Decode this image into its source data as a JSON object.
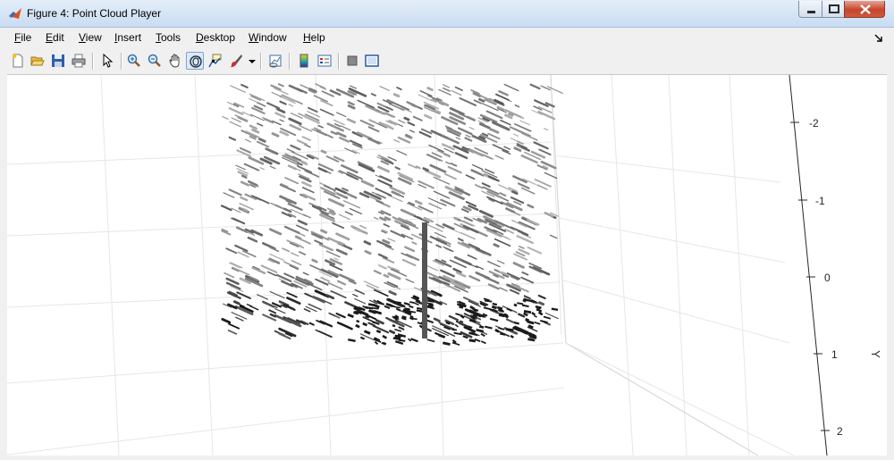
{
  "window": {
    "title": "Figure 4: Point Cloud Player"
  },
  "menu": [
    {
      "pre": "",
      "u": "F",
      "post": "ile"
    },
    {
      "pre": "",
      "u": "E",
      "post": "dit"
    },
    {
      "pre": "",
      "u": "V",
      "post": "iew"
    },
    {
      "pre": "",
      "u": "I",
      "post": "nsert"
    },
    {
      "pre": "",
      "u": "T",
      "post": "ools"
    },
    {
      "pre": "",
      "u": "D",
      "post": "esktop"
    },
    {
      "pre": "",
      "u": "W",
      "post": "indow"
    },
    {
      "pre": "",
      "u": "H",
      "post": "elp"
    }
  ],
  "toolbar_icons": [
    "new-figure-icon",
    "open-file-icon",
    "save-icon",
    "print-icon",
    "select-pointer-icon",
    "zoom-in-icon",
    "zoom-out-icon",
    "pan-hand-icon",
    "rotate-3d-icon",
    "data-cursor-icon",
    "brush-icon",
    "brush-dropdown-icon",
    "link-plot-icon",
    "colorbar-icon",
    "legend-icon",
    "hide-plot-tools-icon",
    "show-plot-tools-icon"
  ],
  "axes": {
    "y_label": "Y",
    "y_ticks": [
      "-2",
      "-1",
      "0",
      "1",
      "2"
    ]
  },
  "colors": {
    "point_light": "#9a9a9a",
    "point_dark": "#1a1a1a",
    "grid": "#e6e6e6"
  }
}
